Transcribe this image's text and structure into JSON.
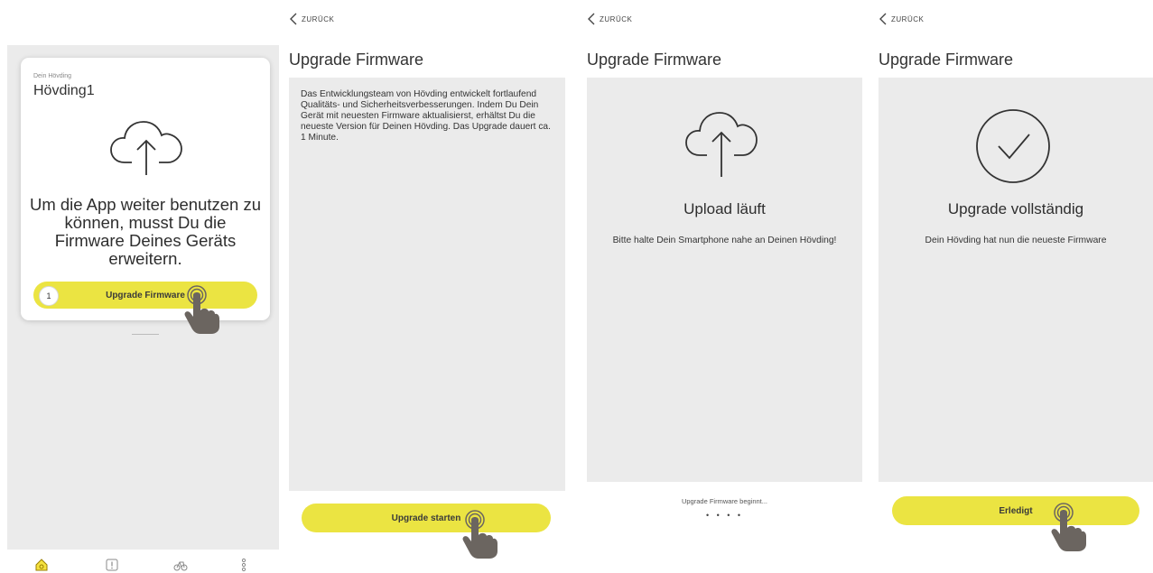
{
  "screen1": {
    "device_label": "Dein Hövding",
    "device_name": "Hövding1",
    "message": "Um die App weiter benutzen zu können, musst Du die Firmware Deines Geräts erweitern.",
    "step_number": "1",
    "button_label": "Upgrade Firmware",
    "icons": [
      "cloud-upload-icon",
      "home-icon",
      "alert-icon",
      "bike-icon",
      "settings-icon"
    ]
  },
  "screen2": {
    "back_label": "ZURÜCK",
    "title": "Upgrade Firmware",
    "body": "Das Entwicklungsteam von Hövding entwickelt fortlaufend Qualitäts- und Sicherheitsverbesserungen. Indem Du Dein Gerät mit neuesten Firmware aktualisierst, erhältst Du die neueste Version für Deinen Hövding. Das Upgrade dauert ca. 1 Minute.",
    "button_label": "Upgrade starten"
  },
  "screen3": {
    "back_label": "ZURÜCK",
    "title": "Upgrade Firmware",
    "heading": "Upload läuft",
    "subtext": "Bitte halte Dein Smartphone nahe an Deinen Hövding!",
    "progress_text": "Upgrade Firmware beginnt...",
    "dots": "• • • •"
  },
  "screen4": {
    "back_label": "ZURÜCK",
    "title": "Upgrade Firmware",
    "heading": "Upgrade vollständig",
    "subtext": "Dein Hövding hat nun die neueste Firmware",
    "button_label": "Erledigt"
  },
  "colors": {
    "accent_yellow": "#ebe442",
    "panel_gray": "#ebebeb",
    "home_icon_yellow": "#e3c51d"
  }
}
